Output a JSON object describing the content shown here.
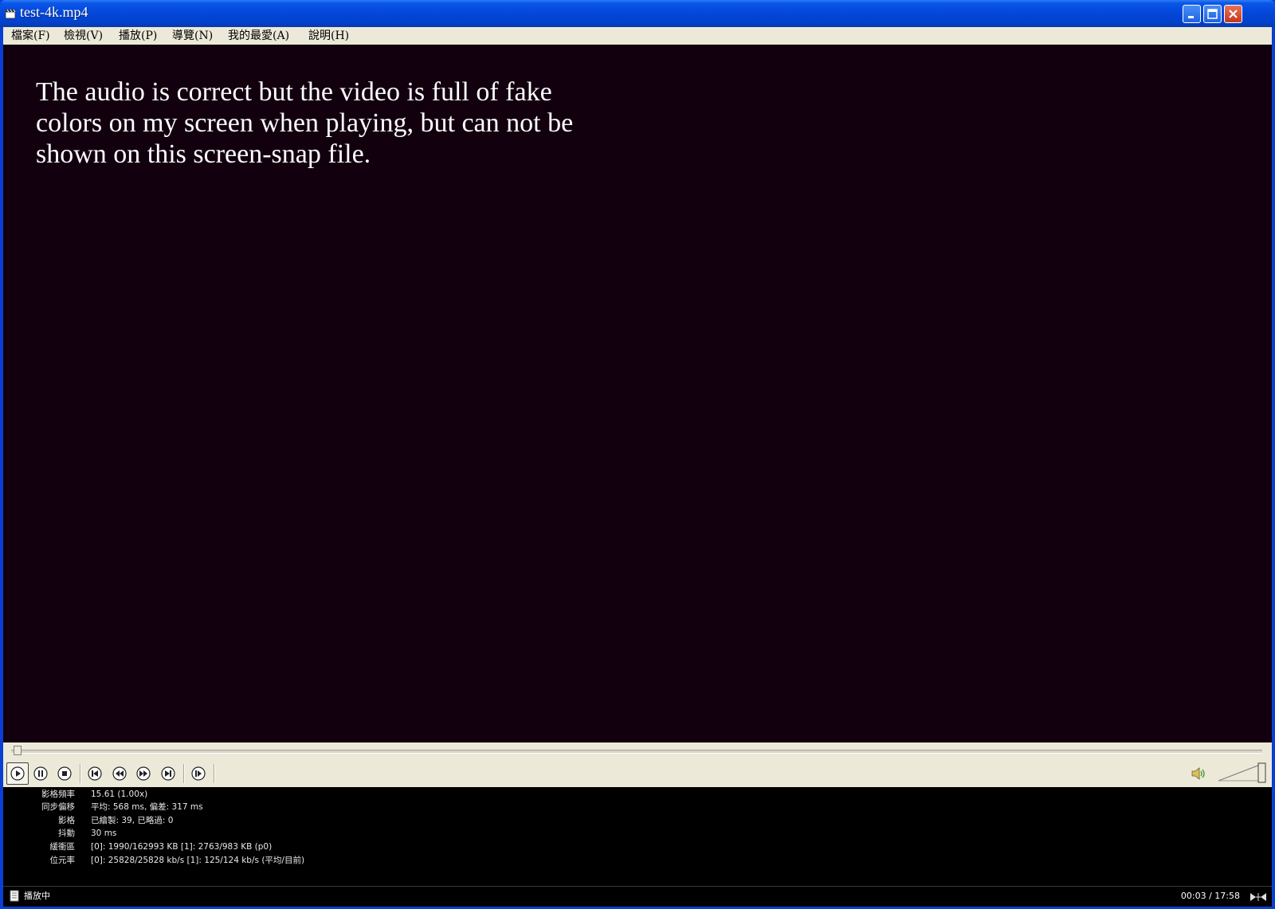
{
  "window": {
    "title": "test-4k.mp4",
    "icons": {
      "app": "film-clapper-icon",
      "minimize": "minimize-icon",
      "maximize": "maximize-icon",
      "close": "close-icon"
    }
  },
  "menu": {
    "items": [
      "檔案(F)",
      "檢視(V)",
      "播放(P)",
      "導覽(N)",
      "我的最愛(A)",
      "說明(H)"
    ]
  },
  "video": {
    "overlay_text": "The audio is correct but the video is full of fake colors on my screen when playing, but can not be shown on this screen-snap file.",
    "background": "#12000f"
  },
  "seekbar": {
    "position_fraction": 0.003
  },
  "controls": {
    "buttons": [
      "play",
      "pause",
      "stop",
      "previous",
      "rewind",
      "fast-forward",
      "next",
      "frame-step"
    ],
    "volume_level": 1.0
  },
  "stats": {
    "rows": [
      {
        "label": "影格頻率",
        "value": "15.61 (1.00x)"
      },
      {
        "label": "同步偏移",
        "value": "平均: 568 ms, 偏差: 317 ms"
      },
      {
        "label": "影格",
        "value": "已繪製: 39, 已略過: 0"
      },
      {
        "label": "抖動",
        "value": "30 ms"
      },
      {
        "label": "緩衝區",
        "value": "[0]: 1990/162993 KB [1]: 2763/983 KB (p0)"
      },
      {
        "label": "位元率",
        "value": "[0]: 25828/25828 kb/s [1]: 125/124 kb/s (平均/目前)"
      }
    ]
  },
  "status": {
    "text": "播放中",
    "time": "00:03 / 17:58"
  }
}
